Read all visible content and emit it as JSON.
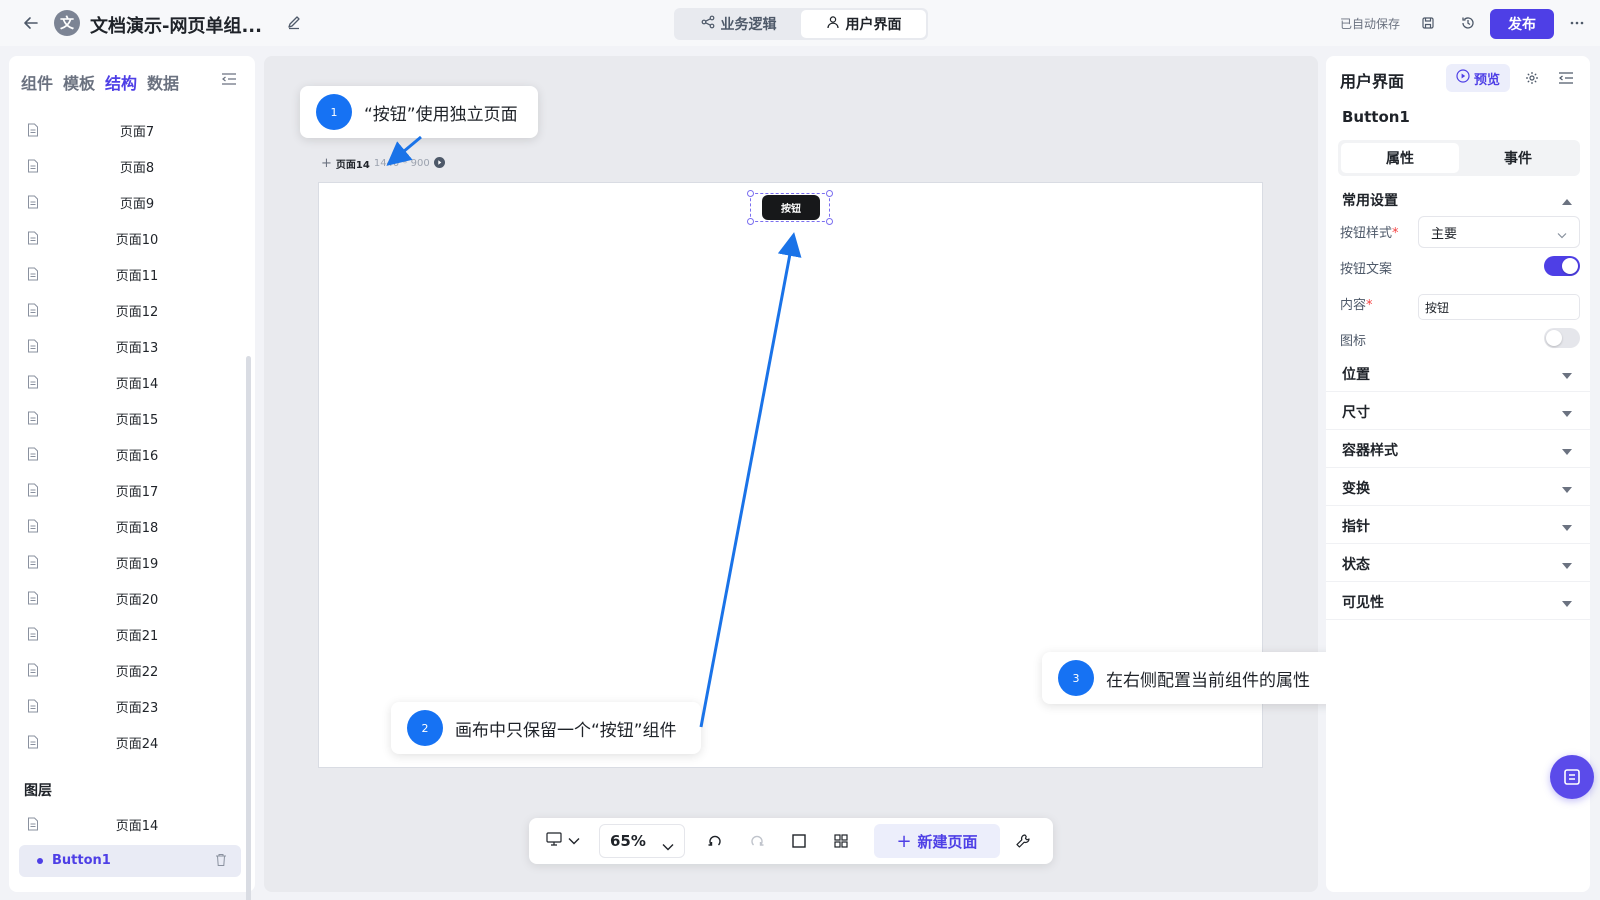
{
  "header": {
    "avatar_char": "文",
    "title": "文档演示-网页单组...",
    "mode_tabs": [
      {
        "label": "业务逻辑",
        "icon": "share-nodes-icon"
      },
      {
        "label": "用户界面",
        "icon": "user-icon"
      }
    ],
    "active_mode": "用户界面",
    "autosave": "已自动保存",
    "publish_label": "发布"
  },
  "left_panel": {
    "tabs": [
      "组件",
      "模板",
      "结构",
      "数据"
    ],
    "active_tab": "结构",
    "pages": [
      "页面7",
      "页面8",
      "页面9",
      "页面10",
      "页面11",
      "页面12",
      "页面13",
      "页面14",
      "页面15",
      "页面16",
      "页面17",
      "页面18",
      "页面19",
      "页面20",
      "页面21",
      "页面22",
      "页面23",
      "页面24"
    ],
    "layers_title": "图层",
    "layer_page": "页面14",
    "layer_component": "Button1"
  },
  "canvas": {
    "page_name": "页面14",
    "page_size": "1440 * 900",
    "button_text": "按钮"
  },
  "callouts": [
    {
      "num": "1",
      "text": "“按钮”使用独立页面"
    },
    {
      "num": "2",
      "text": "画布中只保留一个“按钮”组件"
    },
    {
      "num": "3",
      "text": "在右侧配置当前组件的属性"
    }
  ],
  "toolbar": {
    "zoom": "65%",
    "new_page_label": "新建页面"
  },
  "right_panel": {
    "title": "用户界面",
    "preview_label": "预览",
    "component_name": "Button1",
    "tabs": [
      "属性",
      "事件"
    ],
    "active_tab": "属性",
    "common_section": "常用设置",
    "fields": {
      "style_label": "按钮样式",
      "style_value": "主要",
      "text_label": "按钮文案",
      "text_toggle_on": true,
      "content_label": "内容",
      "content_value": "按钮",
      "icon_label": "图标",
      "icon_toggle_on": false
    },
    "sections": [
      "位置",
      "尺寸",
      "容器样式",
      "变换",
      "指针",
      "状态",
      "可见性"
    ]
  },
  "colors": {
    "accent": "#4e3fe6",
    "callout_blue": "#1672f3",
    "arrow_blue": "#1a73e8"
  }
}
